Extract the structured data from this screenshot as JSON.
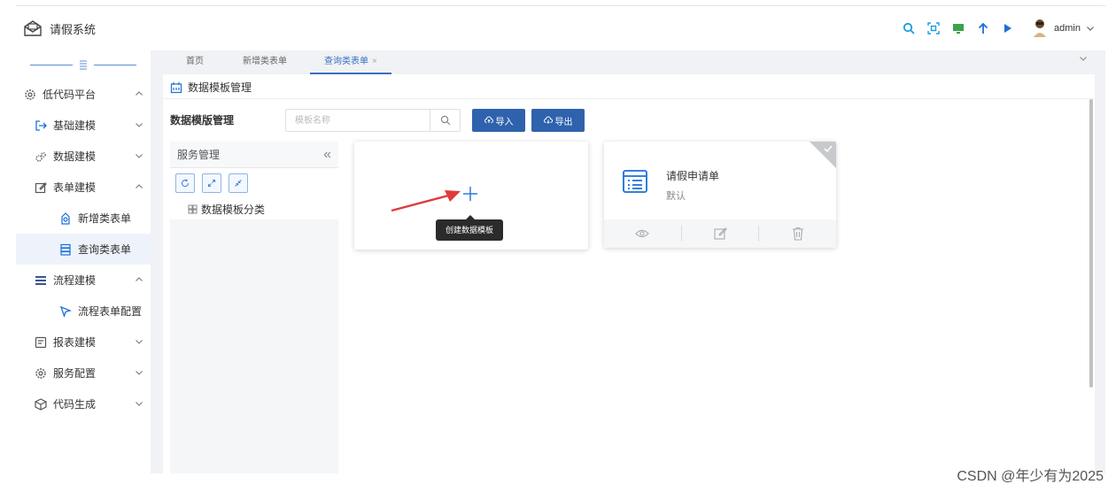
{
  "app": {
    "title": "请假系统"
  },
  "header": {
    "tools": [
      "search-icon",
      "fullscreen-icon",
      "monitor-icon",
      "arrow-up-icon",
      "play-icon"
    ],
    "user": "admin"
  },
  "sidebar": {
    "items": [
      {
        "label": "低代码平台",
        "icon": "gear-icon",
        "expanded": true
      },
      {
        "label": "基础建模",
        "icon": "logout-icon",
        "expanded": false
      },
      {
        "label": "数据建模",
        "icon": "gears-icon",
        "expanded": false
      },
      {
        "label": "表单建模",
        "icon": "edit-icon",
        "expanded": true
      },
      {
        "label": "新增类表单",
        "icon": "form-add-icon"
      },
      {
        "label": "查询类表单",
        "icon": "database-icon",
        "active": true
      },
      {
        "label": "流程建模",
        "icon": "menu-icon",
        "expanded": true
      },
      {
        "label": "流程表单配置",
        "icon": "cursor-icon"
      },
      {
        "label": "报表建模",
        "icon": "report-icon",
        "expanded": false
      },
      {
        "label": "服务配置",
        "icon": "gear-icon",
        "expanded": false
      },
      {
        "label": "代码生成",
        "icon": "cube-icon",
        "expanded": false
      }
    ]
  },
  "tabs": [
    {
      "label": "首页"
    },
    {
      "label": "新增类表单"
    },
    {
      "label": "查询类表单",
      "active": true,
      "close": "×"
    }
  ],
  "panel": {
    "title": "数据模板管理",
    "toolbar_label": "数据模版管理",
    "search_placeholder": "模板名称",
    "import_label": "导入",
    "export_label": "导出"
  },
  "tree": {
    "title": "服务管理",
    "collapse": "«",
    "node_label": "数据模板分类"
  },
  "create_card": {
    "tooltip": "创建数据模板"
  },
  "template_card": {
    "title": "请假申请单",
    "subtitle": "默认"
  },
  "watermark": "CSDN @年少有为2025",
  "colors": {
    "accent": "#2f62ad",
    "tab_active": "#3a6fc2",
    "arrow": "#e03a3a"
  }
}
